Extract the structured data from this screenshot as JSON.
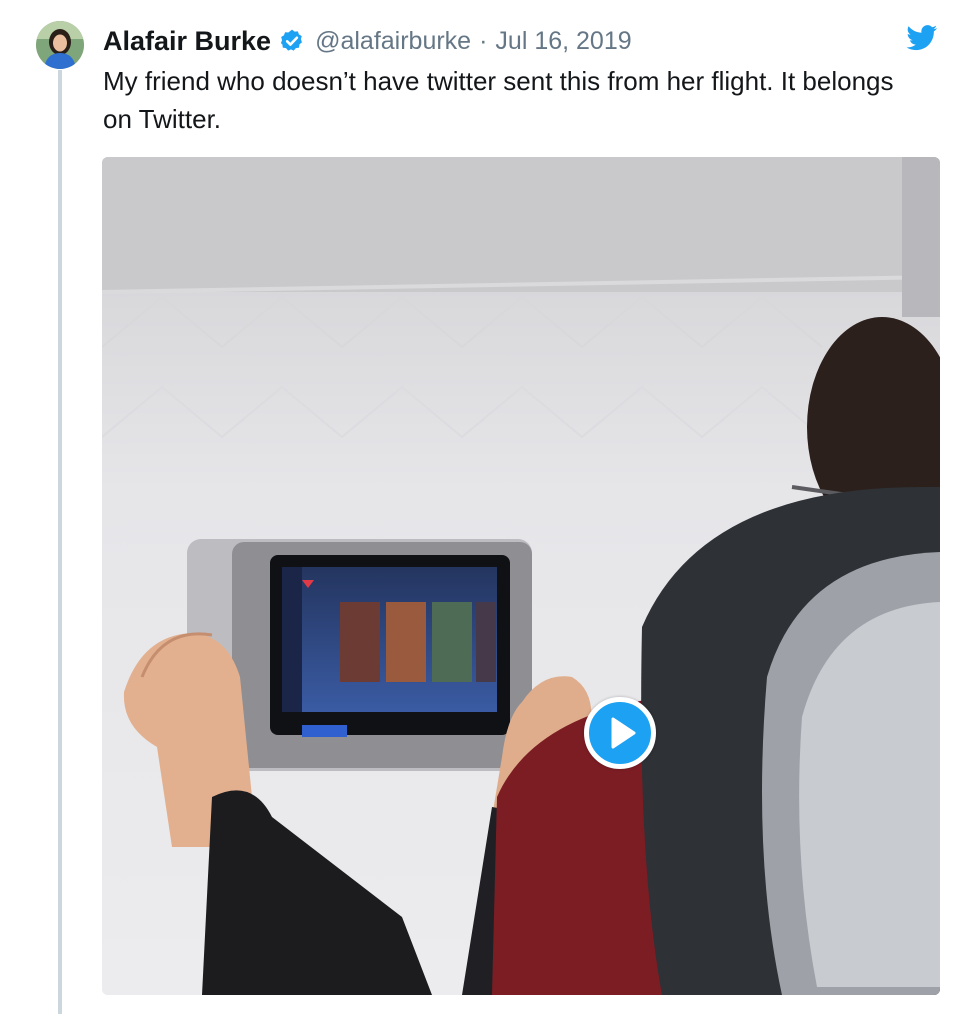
{
  "tweet": {
    "author_name": "Alafair Burke",
    "handle": "@alafairburke",
    "separator": "·",
    "date": "Jul 16, 2019",
    "text": "My friend who doesn’t have twitter sent this from her flight. It belongs on Twitter."
  },
  "icons": {
    "verified": "verified-badge-icon",
    "brand": "twitter-bird-icon",
    "play": "play-icon"
  },
  "colors": {
    "brand_blue": "#1da1f2",
    "thread_line": "#ccd6dd",
    "secondary_text": "#657786"
  }
}
